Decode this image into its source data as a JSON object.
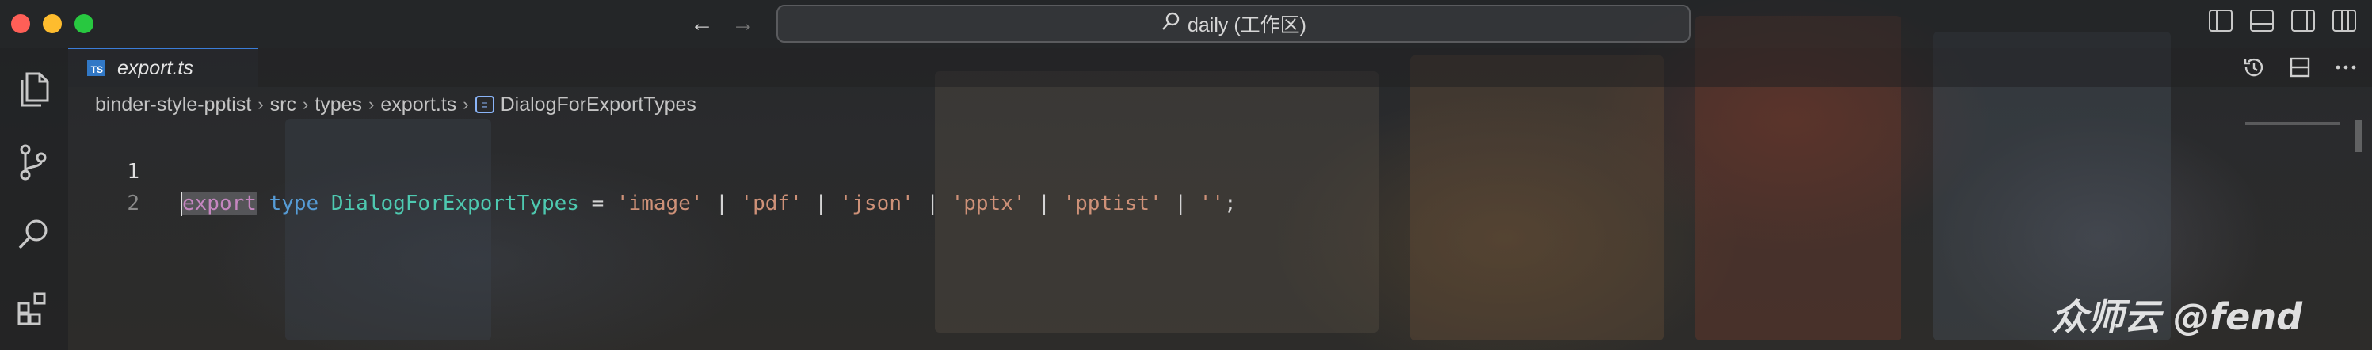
{
  "window": {
    "command_center_label": "daily (工作区)"
  },
  "tabs": [
    {
      "label": "export.ts",
      "badge": "TS"
    }
  ],
  "breadcrumb": {
    "items": [
      "binder-style-pptist",
      "src",
      "types",
      "export.ts"
    ],
    "symbol": "DialogForExportTypes"
  },
  "editor": {
    "lines": [
      {
        "number": "1",
        "tokens": {
          "export": "export",
          "type": "type",
          "name": "DialogForExportTypes",
          "eq": " = ",
          "s1": "'image'",
          "s2": "'pdf'",
          "s3": "'json'",
          "s4": "'pptx'",
          "s5": "'pptist'",
          "s6": "''",
          "pipe": " | ",
          "semi": ";"
        }
      },
      {
        "number": "2"
      }
    ]
  },
  "watermark": "众师云 @fend",
  "colors": {
    "accent": "#3b7dd8",
    "keyword": "#569cd6",
    "type_name": "#4ec9b0",
    "string": "#ce9178"
  },
  "icons": {
    "activity": [
      "explorer-icon",
      "source-control-icon",
      "search-icon",
      "extensions-icon"
    ],
    "editor_actions": [
      "timeline-icon",
      "split-editor-icon",
      "more-actions-icon"
    ]
  }
}
